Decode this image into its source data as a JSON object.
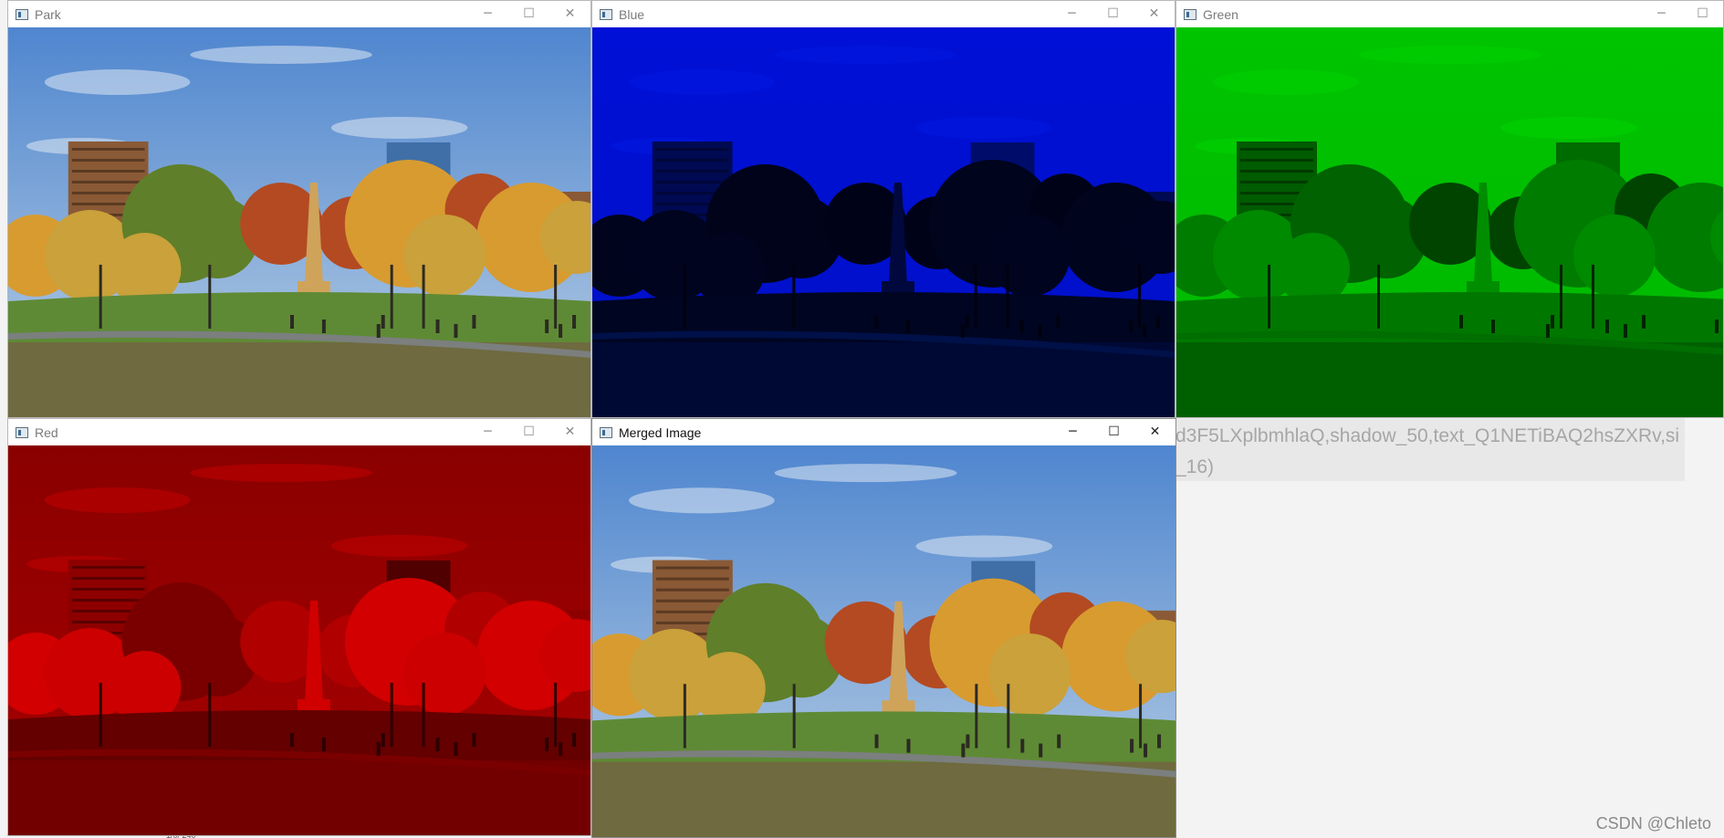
{
  "background": {
    "url_fragment_line1": "d3F5LXplbmhlaQ,shadow_50,text_Q1NETiBAQ2hsZXRv,si",
    "url_fragment_line2": "_16)",
    "watermark": "CSDN @Chleto",
    "bottom_stub": "1/0/ 240"
  },
  "windows": [
    {
      "id": "park",
      "title": "Park",
      "tint": "original",
      "active": false,
      "controls": {
        "minimize": "─",
        "maximize": "☐",
        "close": "✕"
      }
    },
    {
      "id": "blue",
      "title": "Blue",
      "tint": "blue",
      "active": false,
      "controls": {
        "minimize": "─",
        "maximize": "☐",
        "close": "✕"
      }
    },
    {
      "id": "green",
      "title": "Green",
      "tint": "green",
      "active": false,
      "controls": {
        "minimize": "─",
        "maximize": "☐"
      }
    },
    {
      "id": "red",
      "title": "Red",
      "tint": "red",
      "active": false,
      "controls": {
        "minimize": "─",
        "maximize": "☐",
        "close": "✕"
      }
    },
    {
      "id": "merged",
      "title": "Merged Image",
      "tint": "original",
      "active": true,
      "controls": {
        "minimize": "─",
        "maximize": "☐",
        "close": "✕"
      }
    }
  ],
  "palettes": {
    "original": {
      "sky1": "#4f86cf",
      "sky2": "#b9cfe4",
      "cloud": "#dfe8f2",
      "bldg": "#8a5a36",
      "bldg_win": "#5b3a22",
      "tower": "#3f6fa6",
      "tree1": "#caa13a",
      "tree2": "#5f7f2a",
      "tree3": "#b34a22",
      "tree4": "#d89b30",
      "grass": "#5f8a35",
      "ground": "#6f6a3f",
      "path": "#7b7f7e",
      "dark": "#2b2a22",
      "monument": "#cfa35a"
    },
    "blue": {
      "sky1": "#0010d6",
      "sky2": "#0010c8",
      "cloud": "#0018e0",
      "bldg": "#000a52",
      "bldg_win": "#000638",
      "tower": "#000c6a",
      "tree1": "#00041e",
      "tree2": "#00031a",
      "tree3": "#000318",
      "tree4": "#00041c",
      "grass": "#000522",
      "ground": "#000934",
      "path": "#001048",
      "dark": "#000210",
      "monument": "#00083e"
    },
    "green": {
      "sky1": "#00c400",
      "sky2": "#00b800",
      "cloud": "#00d200",
      "bldg": "#005c00",
      "bldg_win": "#003a00",
      "tower": "#006c00",
      "tree1": "#008a00",
      "tree2": "#006200",
      "tree3": "#004400",
      "tree4": "#007c00",
      "grass": "#007800",
      "ground": "#006000",
      "path": "#006e00",
      "dark": "#002400",
      "monument": "#008e00"
    },
    "red": {
      "sky1": "#8a0000",
      "sky2": "#a80000",
      "cloud": "#c20000",
      "bldg": "#8e0000",
      "bldg_win": "#5a0000",
      "tower": "#500000",
      "tree1": "#cc0000",
      "tree2": "#7a0000",
      "tree3": "#b00000",
      "tree4": "#d20000",
      "grass": "#640000",
      "ground": "#720000",
      "path": "#7a0000",
      "dark": "#2c0000",
      "monument": "#d00000"
    }
  }
}
